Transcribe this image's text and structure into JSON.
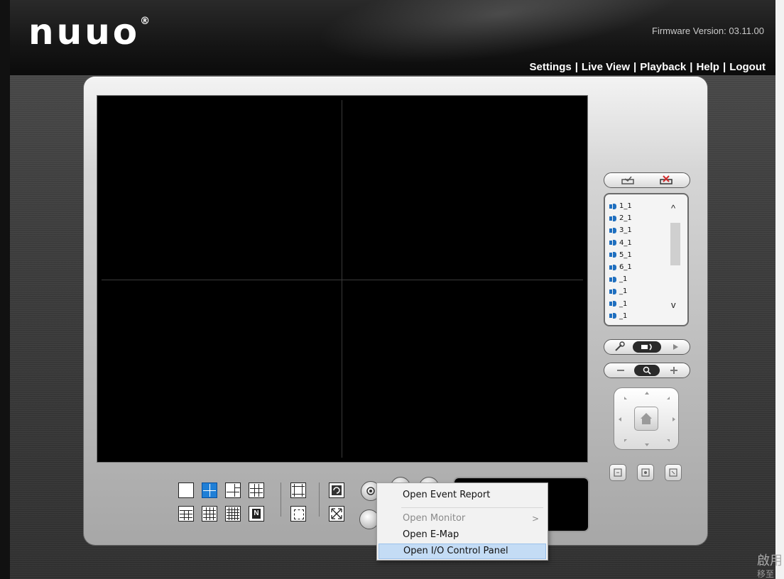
{
  "header": {
    "logo_text": "nuuo",
    "logo_mark": "®",
    "firmware": "Firmware Version: 03.11.00",
    "nav": [
      {
        "label": "Settings"
      },
      {
        "label": "Live View"
      },
      {
        "label": "Playback"
      },
      {
        "label": "Help"
      },
      {
        "label": "Logout"
      }
    ],
    "separator": "|"
  },
  "camera_list": {
    "items": [
      {
        "label": "1_1"
      },
      {
        "label": "2_1"
      },
      {
        "label": "3_1"
      },
      {
        "label": "4_1"
      },
      {
        "label": "5_1"
      },
      {
        "label": "6_1"
      },
      {
        "label": "_1"
      },
      {
        "label": "_1"
      },
      {
        "label": "_1"
      },
      {
        "label": "_1"
      }
    ],
    "scroll_up": "^",
    "scroll_down": "v"
  },
  "layout_buttons": {
    "n_label": "N"
  },
  "context_menu": {
    "items": [
      {
        "label": "Open Event Report",
        "state": "normal"
      },
      {
        "label": "Open Monitor",
        "state": "disabled",
        "submenu_arrow": ">"
      },
      {
        "label": "Open E-Map",
        "state": "normal"
      },
      {
        "label": "Open I/O Control Panel",
        "state": "highlighted"
      }
    ]
  },
  "corner_text": "啟用",
  "corner_text2": "移至",
  "colors": {
    "accent": "#1f7fd6",
    "menu_highlight": "#c4dcf5",
    "camera_icon": "#1f6fbf"
  }
}
